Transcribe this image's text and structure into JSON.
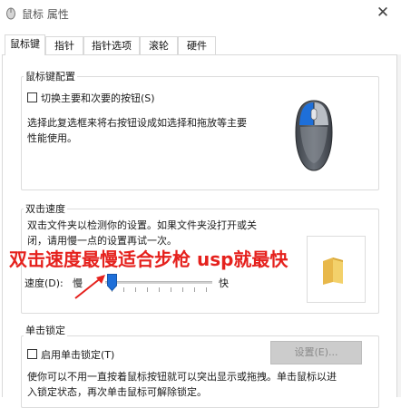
{
  "window": {
    "title": "鼠标 属性",
    "close_glyph": "✕"
  },
  "tabs": [
    {
      "label": "鼠标键",
      "active": true
    },
    {
      "label": "指针"
    },
    {
      "label": "指针选项"
    },
    {
      "label": "滚轮"
    },
    {
      "label": "硬件"
    }
  ],
  "button_config": {
    "group_title": "鼠标键配置",
    "checkbox_label": "切换主要和次要的按钮(S)",
    "checked": false,
    "description_line1": "选择此复选框来将右按钮设成如选择和拖放等主要",
    "description_line2": "性能使用。"
  },
  "double_click": {
    "group_title": "双击速度",
    "description_line1": "双击文件夹以检测你的设置。如果文件夹没打开或关",
    "description_line2": "闭，请用慢一点的设置再试一次。",
    "speed_label": "速度(D):",
    "slow_label": "慢",
    "fast_label": "快",
    "speed_fraction": 0.0
  },
  "annotation": {
    "text": "双击速度最慢适合步枪 usp就最快",
    "color": "#e5211d"
  },
  "click_lock": {
    "group_title": "单击锁定",
    "checkbox_label": "启用单击锁定(T)",
    "checked": false,
    "settings_button": "设置(E)...",
    "description_line1": "使你可以不用一直按着鼠标按钮就可以突出显示或拖拽。单击鼠标以进",
    "description_line2": "入锁定状态，再次单击鼠标可解除锁定。"
  },
  "colors": {
    "accent_blue": "#1e6fd9",
    "mouse_body": "#5a5f66",
    "folder": "#f3d16b"
  }
}
